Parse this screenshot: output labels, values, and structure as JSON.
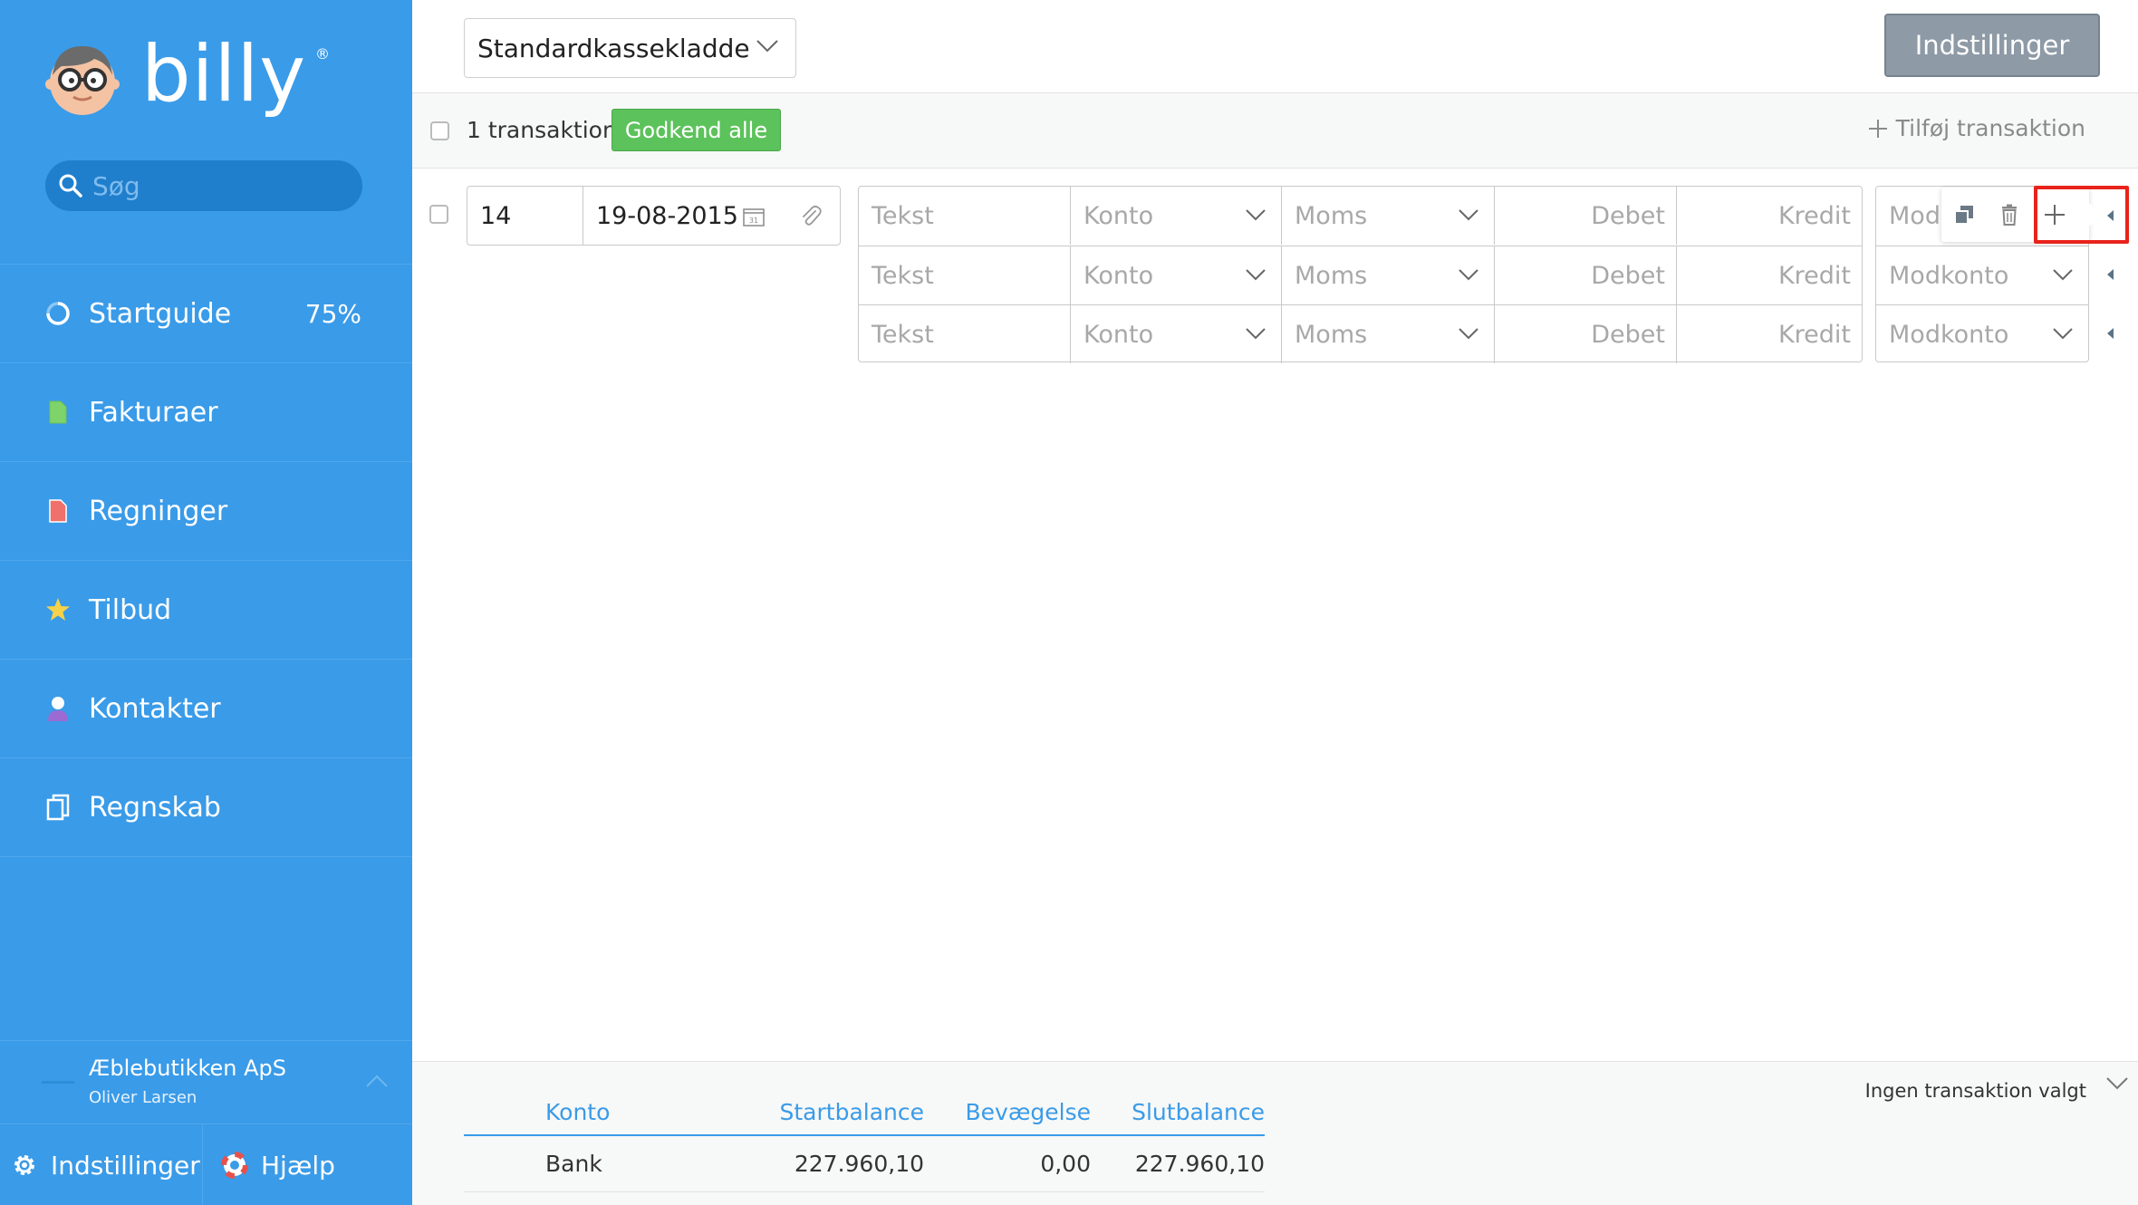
{
  "app": {
    "logo_text": "billy",
    "logo_reg": "®"
  },
  "sidebar": {
    "search_placeholder": "Søg",
    "items": [
      {
        "label": "Startguide",
        "badge": "75%",
        "icon": "progress-ring-icon"
      },
      {
        "label": "Fakturaer",
        "icon": "invoice-doc-icon",
        "color": "#7ed36a"
      },
      {
        "label": "Regninger",
        "icon": "bill-doc-icon",
        "color": "#f0706b"
      },
      {
        "label": "Tilbud",
        "icon": "star-icon",
        "color": "#f5d24a"
      },
      {
        "label": "Kontakter",
        "icon": "person-icon",
        "color": "#9b6bd3"
      },
      {
        "label": "Regnskab",
        "icon": "ledger-icon"
      }
    ],
    "company": {
      "name": "Æblebutikken ApS",
      "user": "Oliver Larsen"
    },
    "bottom": {
      "settings_label": "Indstillinger",
      "help_label": "Hjælp"
    }
  },
  "topbar": {
    "journal_select": "Standardkassekladde",
    "settings_button": "Indstillinger"
  },
  "actionbar": {
    "count_label": "1 transaktion",
    "approve_button": "Godkend alle",
    "add_transaction": "Tilføj transaktion"
  },
  "transaction": {
    "number": "14",
    "date": "19-08-2015",
    "lines": [
      {
        "text": "Tekst",
        "account": "Konto",
        "vat": "Moms",
        "debit": "Debet",
        "credit": "Kredit",
        "contra": "Modkonto"
      },
      {
        "text": "Tekst",
        "account": "Konto",
        "vat": "Moms",
        "debit": "Debet",
        "credit": "Kredit",
        "contra": "Modkonto"
      },
      {
        "text": "Tekst",
        "account": "Konto",
        "vat": "Moms",
        "debit": "Debet",
        "credit": "Kredit",
        "contra": "Modkonto"
      }
    ],
    "first_contra_visible": "Modk"
  },
  "balance": {
    "status": "Ingen transaktion valgt",
    "headers": {
      "account": "Konto",
      "start": "Startbalance",
      "movement": "Bevægelse",
      "end": "Slutbalance"
    },
    "rows": [
      {
        "account": "Bank",
        "start": "227.960,10",
        "movement": "0,00",
        "end": "227.960,10"
      }
    ]
  },
  "colors": {
    "sidebar": "#3a9be8",
    "approve": "#5cc25b",
    "settings_button": "#8e9aa6",
    "highlight": "#e8231c"
  }
}
